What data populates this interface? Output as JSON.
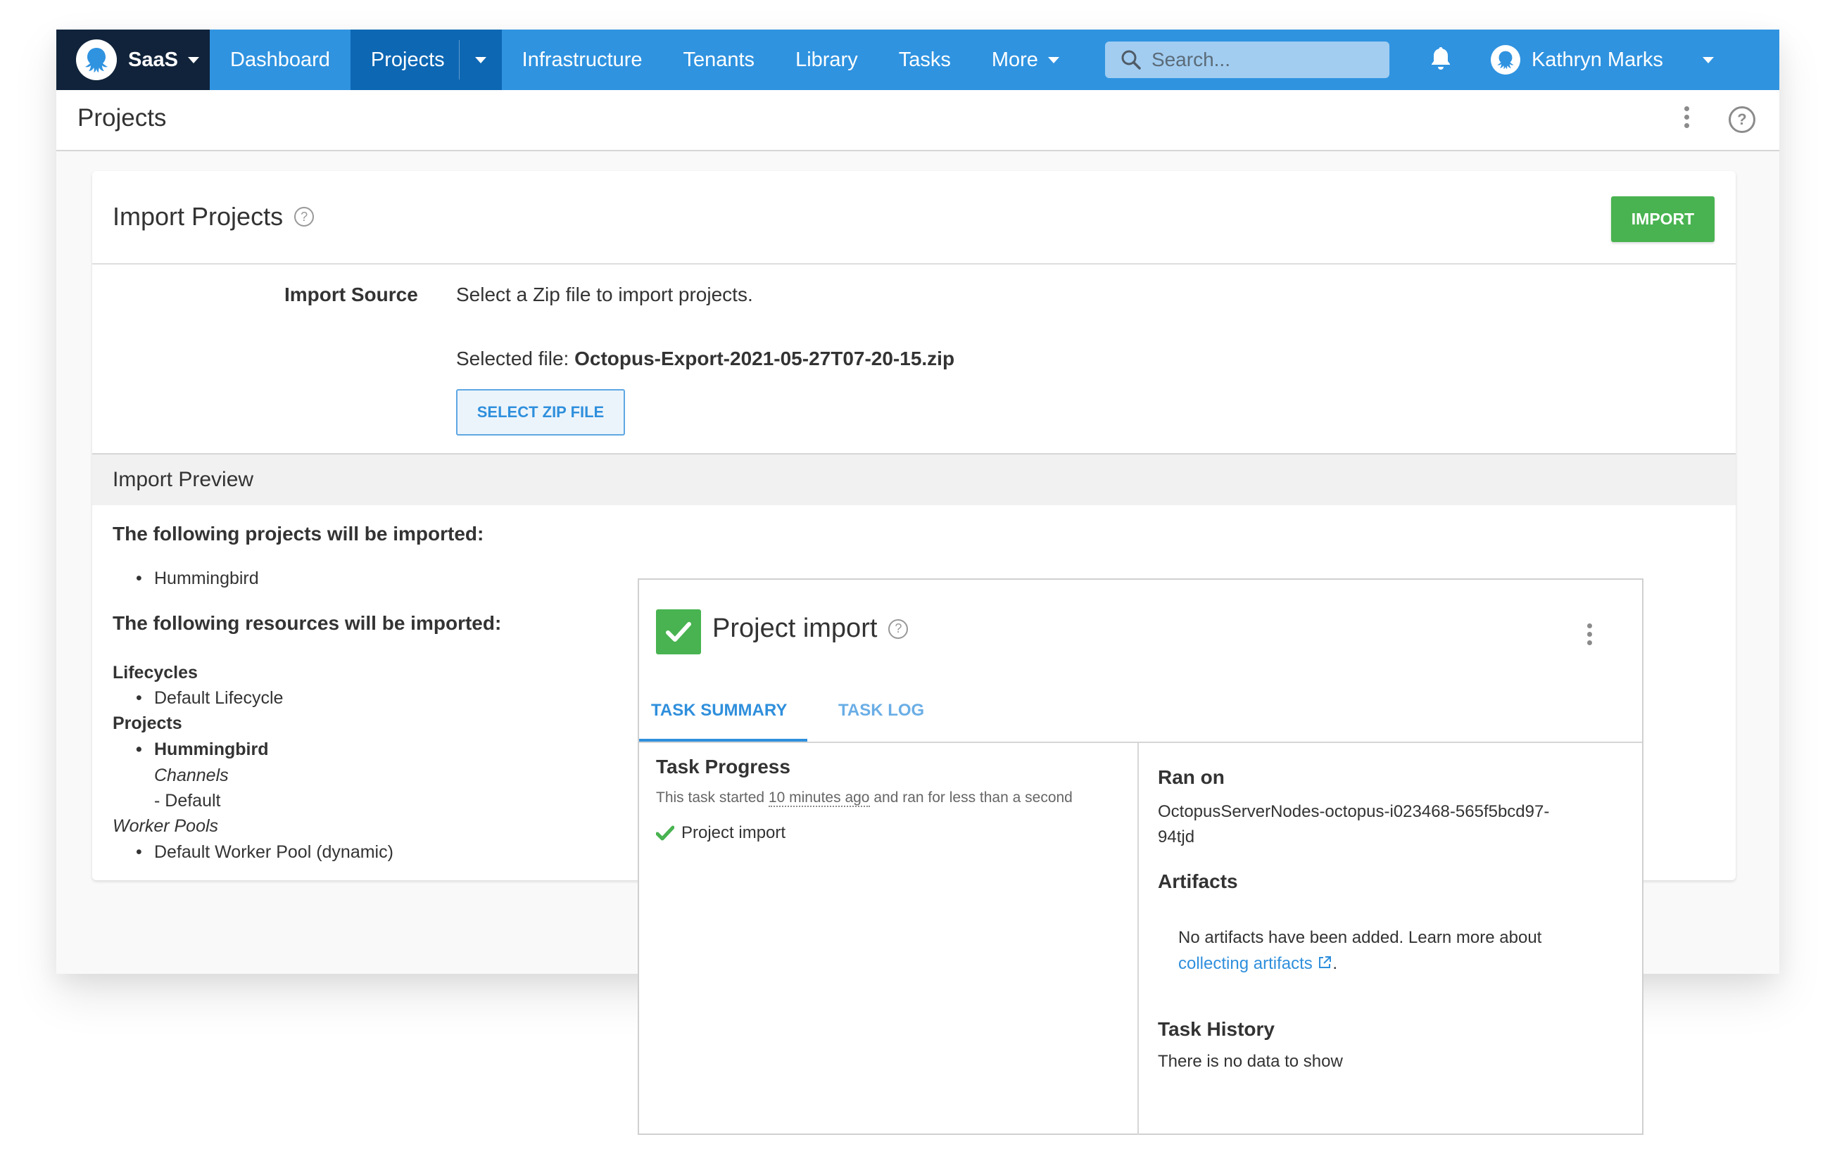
{
  "nav": {
    "brand_label": "SaaS",
    "items": [
      {
        "label": "Dashboard"
      },
      {
        "label": "Projects",
        "active": true
      },
      {
        "label": "Infrastructure"
      },
      {
        "label": "Tenants"
      },
      {
        "label": "Library"
      },
      {
        "label": "Tasks"
      },
      {
        "label": "More"
      }
    ],
    "search_placeholder": "Search...",
    "user_name": "Kathryn Marks",
    "icons": [
      "octopus-logo-icon",
      "caret-down-icon",
      "search-icon",
      "bell-icon",
      "user-avatar-icon"
    ]
  },
  "page": {
    "title": "Projects"
  },
  "import_card": {
    "title": "Import Projects",
    "import_button": "IMPORT",
    "source_label": "Import Source",
    "source_description": "Select a Zip file to import projects.",
    "selected_file_prefix": "Selected file:",
    "selected_file_name": "Octopus-Export-2021-05-27T07-20-15.zip",
    "select_zip_button": "SELECT ZIP FILE"
  },
  "preview": {
    "header": "Import Preview",
    "projects_heading": "The following projects will be imported:",
    "projects": [
      "Hummingbird"
    ],
    "resources_heading": "The following resources will be imported:",
    "resources": {
      "lifecycles_label": "Lifecycles",
      "lifecycles": [
        "Default Lifecycle"
      ],
      "projects_label": "Projects",
      "project_name": "Hummingbird",
      "channels_label": "Channels",
      "channels": [
        "- Default"
      ],
      "worker_pools_label": "Worker Pools",
      "worker_pools": [
        "Default Worker Pool (dynamic)"
      ]
    }
  },
  "task": {
    "title": "Project import",
    "status": "success",
    "status_color": "#48b350",
    "tabs": [
      {
        "label": "TASK SUMMARY",
        "active": true
      },
      {
        "label": "TASK LOG",
        "active": false
      }
    ],
    "progress_heading": "Task Progress",
    "started_prefix": "This task started ",
    "started_relative": "10 minutes ago",
    "started_suffix": " and ran for less than a second",
    "steps": [
      {
        "label": "Project import",
        "status": "success"
      }
    ],
    "ran_on_heading": "Ran on",
    "ran_on_line1": "OctopusServerNodes-octopus-i023468-565f5bcd97-",
    "ran_on_line2": "94tjd",
    "artifacts_heading": "Artifacts",
    "artifacts_text": "No artifacts have been added. Learn more about",
    "artifacts_link": "collecting artifacts",
    "artifacts_suffix": ".",
    "history_heading": "Task History",
    "history_empty": "There is no data to show"
  },
  "colors": {
    "nav_blue": "#2f93e0",
    "nav_active": "#0d67b3",
    "brand_dark": "#10233a",
    "success_green": "#48b350",
    "link_blue": "#2f8fdc"
  }
}
